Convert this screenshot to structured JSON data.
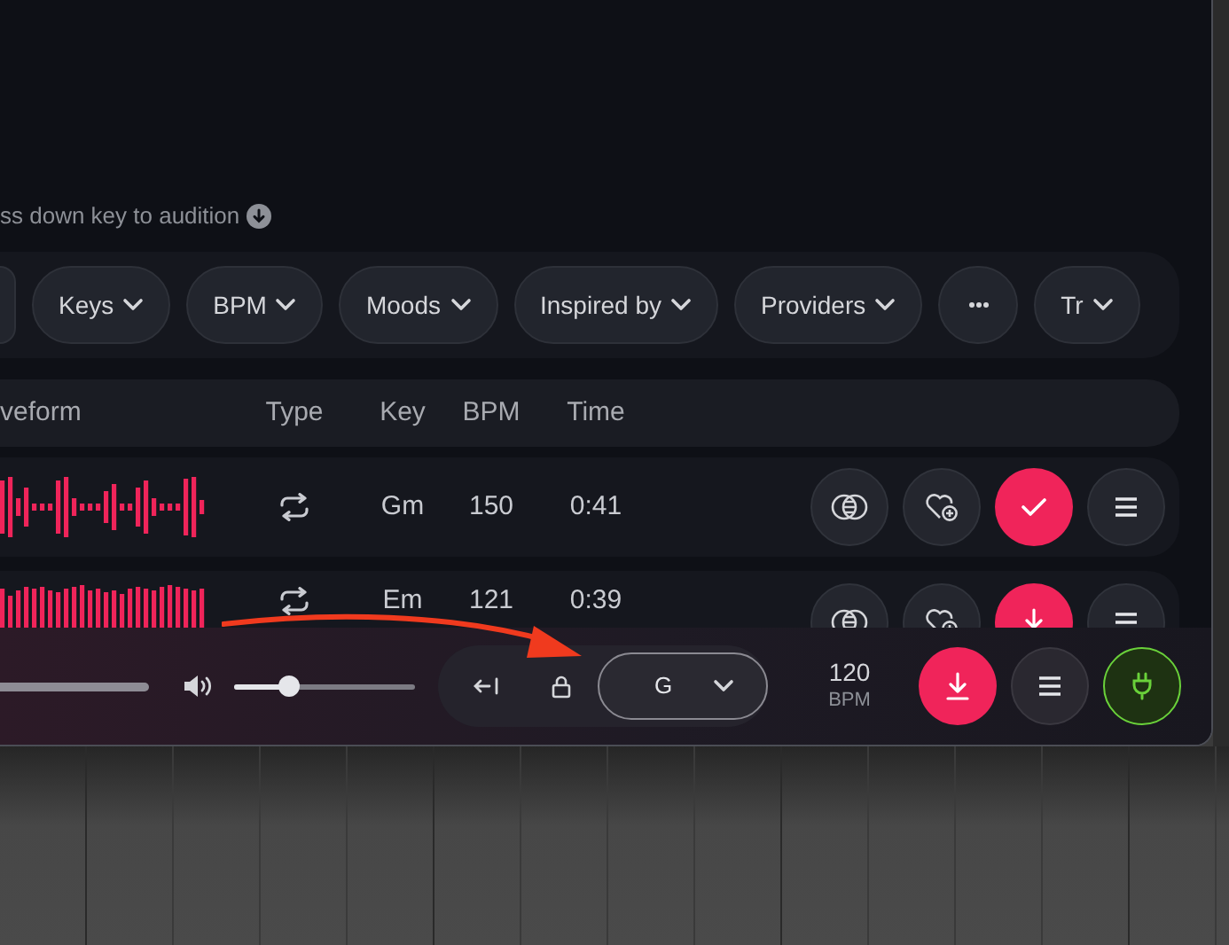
{
  "hint": "ss down key to audition",
  "filters": [
    {
      "kind": "dropdown",
      "label": "Keys"
    },
    {
      "kind": "dropdown",
      "label": "BPM"
    },
    {
      "kind": "dropdown",
      "label": "Moods"
    },
    {
      "kind": "dropdown",
      "label": "Inspired by"
    },
    {
      "kind": "dropdown",
      "label": "Providers"
    },
    {
      "kind": "more"
    },
    {
      "kind": "dropdown",
      "label": "Tr"
    }
  ],
  "columns": [
    "veform",
    "Type",
    "Key",
    "BPM",
    "Time"
  ],
  "rows": [
    {
      "kind": "loop",
      "key": "Gm",
      "bpm": "150",
      "time": "0:41",
      "added": true
    },
    {
      "kind": "loop",
      "key": "Em",
      "bpm": "121",
      "time": "0:39",
      "added": false
    }
  ],
  "player": {
    "progress": {
      "level": 1
    },
    "volume": {
      "level": 0.3
    },
    "key": "G",
    "bpm": "120",
    "bpm_unit": "BPM",
    "plugin_connected": true
  }
}
